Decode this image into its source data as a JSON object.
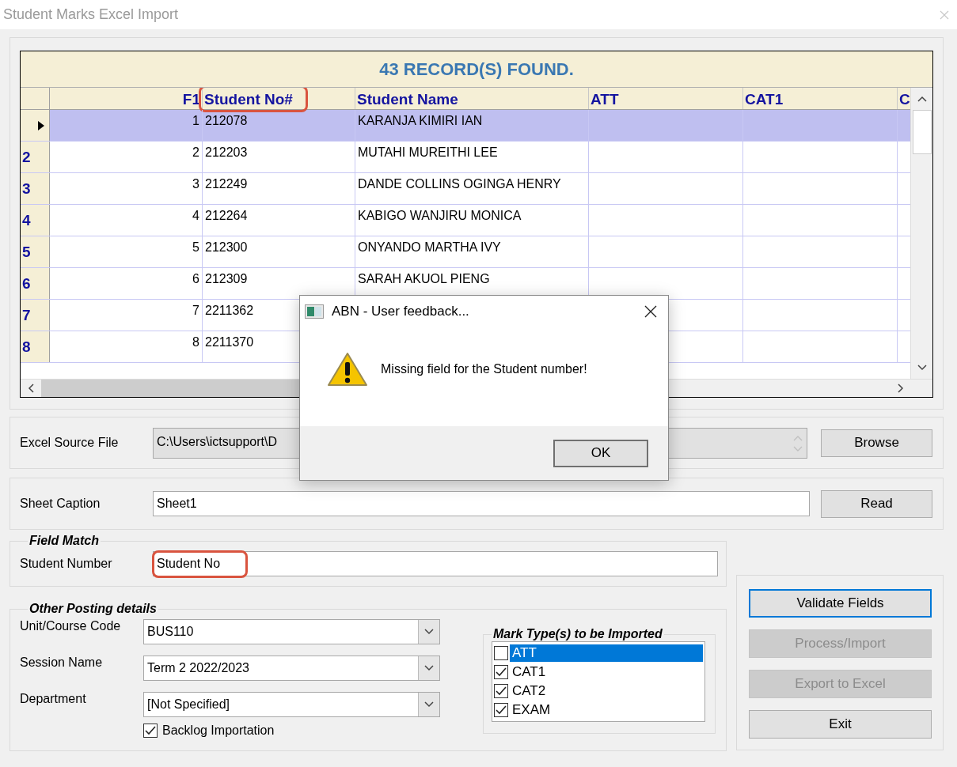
{
  "window": {
    "title": "Student Marks Excel Import"
  },
  "grid": {
    "caption": "43 RECORD(S) FOUND.",
    "columns": [
      {
        "label": "F1"
      },
      {
        "label": "Student No#",
        "highlighted": true
      },
      {
        "label": "Student Name"
      },
      {
        "label": "ATT"
      },
      {
        "label": "CAT1"
      },
      {
        "label": "C"
      }
    ],
    "rows": [
      {
        "current": true,
        "selected": true,
        "cells": [
          "1",
          "212078",
          "KARANJA KIMIRI IAN"
        ]
      },
      {
        "header": "2",
        "current": false,
        "selected": false,
        "cells": [
          "2",
          "212203",
          "MUTAHI MUREITHI LEE"
        ]
      },
      {
        "header": "3",
        "current": false,
        "selected": false,
        "cells": [
          "3",
          "212249",
          "DANDE COLLINS OGINGA HENRY"
        ]
      },
      {
        "header": "4",
        "current": false,
        "selected": false,
        "cells": [
          "4",
          "212264",
          "KABIGO WANJIRU MONICA"
        ]
      },
      {
        "header": "5",
        "current": false,
        "selected": false,
        "cells": [
          "5",
          "212300",
          "ONYANDO MARTHA IVY"
        ]
      },
      {
        "header": "6",
        "current": false,
        "selected": false,
        "cells": [
          "6",
          "212309",
          "SARAH AKUOL PIENG"
        ]
      },
      {
        "header": "7",
        "current": false,
        "selected": false,
        "cells": [
          "7",
          "2211362"
        ]
      },
      {
        "header": "8",
        "current": false,
        "selected": false,
        "cells": [
          "8",
          "2211370"
        ]
      }
    ]
  },
  "source": {
    "label": "Excel Source File",
    "value": "C:\\Users\\ictsupport\\D",
    "disabled": true,
    "button": "Browse"
  },
  "sheet": {
    "label": "Sheet Caption",
    "value": "Sheet1",
    "button": "Read"
  },
  "field_match": {
    "legend": "Field Match",
    "label": "Student Number",
    "value": "Student No",
    "highlighted": true
  },
  "posting": {
    "legend": "Other Posting details",
    "combos": [
      {
        "label": "Unit/Course Code",
        "value": "BUS110"
      },
      {
        "label": "Session Name",
        "value": "Term 2 2022/2023"
      },
      {
        "label": "Department",
        "value": "[Not Specified]"
      }
    ],
    "backlog": {
      "label": "Backlog Importation",
      "checked": true
    }
  },
  "mark_types": {
    "legend": "Mark Type(s) to be Imported",
    "items": [
      {
        "label": "ATT",
        "checked": false,
        "selected": true
      },
      {
        "label": "CAT1",
        "checked": true,
        "selected": false
      },
      {
        "label": "CAT2",
        "checked": true,
        "selected": false
      },
      {
        "label": "EXAM",
        "checked": true,
        "selected": false
      }
    ]
  },
  "actions": [
    {
      "label": "Validate Fields",
      "disabled": false,
      "focused": true
    },
    {
      "label": "Process/Import",
      "disabled": true,
      "focused": false
    },
    {
      "label": "Export to Excel",
      "disabled": true,
      "focused": false
    },
    {
      "label": "Exit",
      "disabled": false,
      "focused": false
    }
  ],
  "dialog": {
    "title": "ABN - User feedback...",
    "message": "Missing field for the Student number!",
    "button": "OK"
  }
}
